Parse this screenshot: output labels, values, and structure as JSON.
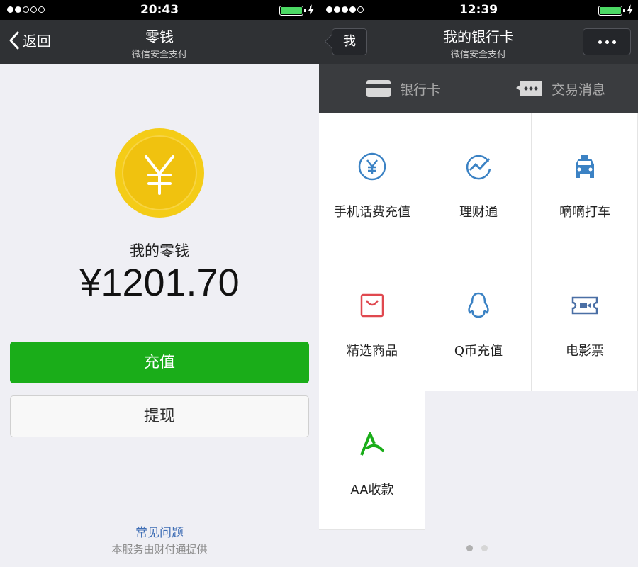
{
  "left": {
    "status": {
      "time": "20:43"
    },
    "nav": {
      "back_label": "返回",
      "title": "零钱",
      "subtitle": "微信安全支付"
    },
    "coin_symbol": "¥",
    "balance_label": "我的零钱",
    "balance_amount": "¥1201.70",
    "recharge_label": "充值",
    "withdraw_label": "提现",
    "faq_label": "常见问题",
    "provider_text": "本服务由财付通提供"
  },
  "right": {
    "status": {
      "time": "12:39"
    },
    "nav": {
      "back_label": "我",
      "title": "我的银行卡",
      "subtitle": "微信安全支付"
    },
    "tabs": [
      {
        "label": "银行卡",
        "icon": "card-icon"
      },
      {
        "label": "交易消息",
        "icon": "message-icon"
      }
    ],
    "services": [
      {
        "label": "手机话费充值",
        "icon": "yuan-circle-icon",
        "color": "#3b82c4"
      },
      {
        "label": "理财通",
        "icon": "trend-icon",
        "color": "#3b82c4"
      },
      {
        "label": "嘀嘀打车",
        "icon": "taxi-icon",
        "color": "#3b82c4"
      },
      {
        "label": "精选商品",
        "icon": "shopping-bag-icon",
        "color": "#e0484f"
      },
      {
        "label": "Q币充值",
        "icon": "penguin-icon",
        "color": "#3b82c4"
      },
      {
        "label": "电影票",
        "icon": "ticket-icon",
        "color": "#4a6fa5"
      },
      {
        "label": "AA收款",
        "icon": "aa-icon",
        "color": "#1aad19"
      }
    ]
  },
  "colors": {
    "accent_green": "#1aad19",
    "coin_yellow": "#f4cc17",
    "link_blue": "#3f6eb5"
  }
}
